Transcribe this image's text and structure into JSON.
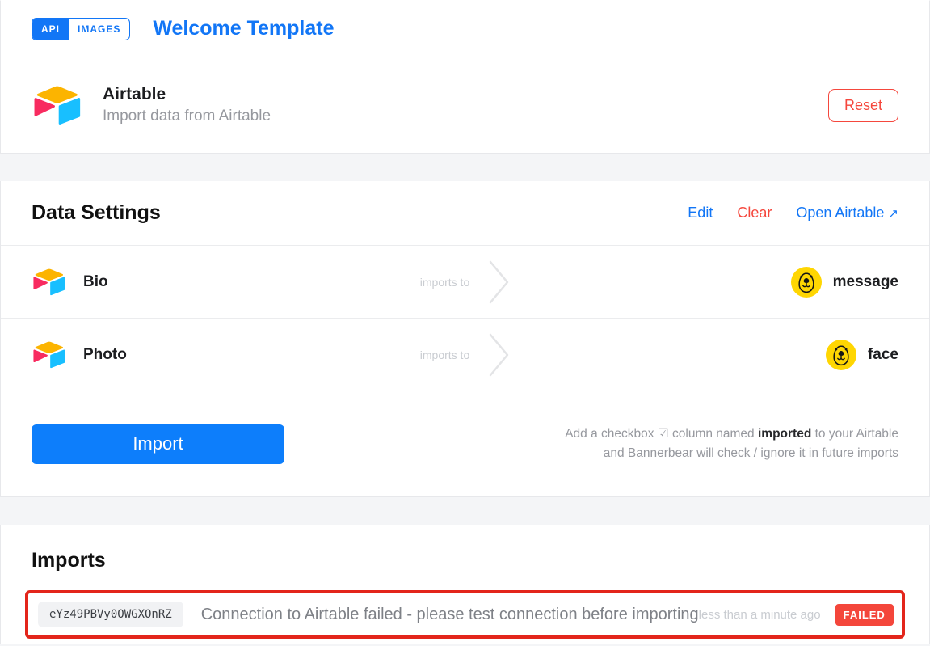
{
  "header": {
    "badge_api": "API",
    "badge_images": "IMAGES",
    "title": "Welcome Template"
  },
  "integration": {
    "name": "Airtable",
    "description": "Import data from Airtable",
    "reset_label": "Reset"
  },
  "data_settings": {
    "title": "Data Settings",
    "actions": {
      "edit": "Edit",
      "clear": "Clear",
      "open_airtable": "Open Airtable",
      "open_arrow": "↗"
    },
    "rows": [
      {
        "source": "Bio",
        "relation": "imports to",
        "target": "message"
      },
      {
        "source": "Photo",
        "relation": "imports to",
        "target": "face"
      }
    ],
    "import_button": "Import",
    "note": {
      "part1": "Add a checkbox ",
      "checkbox_glyph": "☑",
      "part2": " column named ",
      "bold": "imported",
      "part3": " to your Airtable",
      "line2": "and Bannerbear will check / ignore it in future imports"
    }
  },
  "imports": {
    "title": "Imports",
    "entries": [
      {
        "id": "eYz49PBVy0OWGXOnRZ",
        "message": "Connection to Airtable failed - please test connection before importing",
        "time": "less than a minute ago",
        "status": "FAILED"
      }
    ]
  },
  "colors": {
    "primary_blue": "#1276f6",
    "button_blue": "#0d7efb",
    "danger_red": "#f5473d",
    "failed_badge_red": "#f4463b",
    "highlight_border_red": "#e3251b",
    "bannerbear_yellow": "#ffd602",
    "airtable_yellow": "#fcb400",
    "airtable_blue": "#18bfff",
    "airtable_red": "#f82b60"
  }
}
